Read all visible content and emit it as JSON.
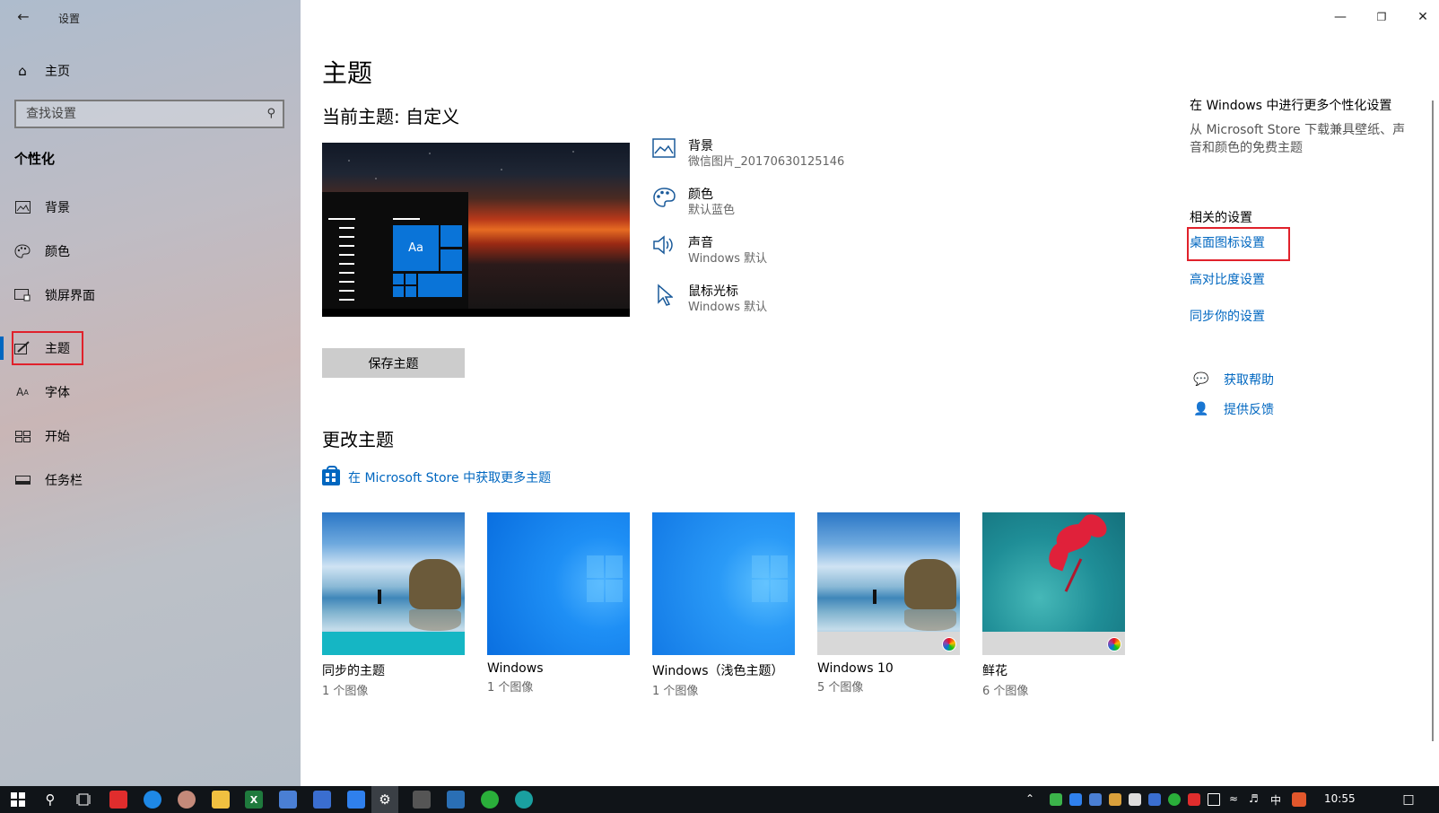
{
  "window": {
    "title": "设置"
  },
  "sidebar": {
    "home_label": "主页",
    "search_placeholder": "查找设置",
    "section_title": "个性化",
    "items": [
      {
        "label": "背景",
        "icon": "image-icon"
      },
      {
        "label": "颜色",
        "icon": "palette-icon"
      },
      {
        "label": "锁屏界面",
        "icon": "lockscreen-icon"
      },
      {
        "label": "主题",
        "icon": "theme-icon",
        "active": true
      },
      {
        "label": "字体",
        "icon": "font-icon"
      },
      {
        "label": "开始",
        "icon": "start-icon"
      },
      {
        "label": "任务栏",
        "icon": "taskbar-icon"
      }
    ]
  },
  "main": {
    "title": "主题",
    "current_theme": "当前主题: 自定义",
    "preview_aa": "Aa",
    "properties": [
      {
        "name": "背景",
        "value": "微信图片_20170630125146",
        "icon": "image-icon"
      },
      {
        "name": "颜色",
        "value": "默认蓝色",
        "icon": "palette-icon"
      },
      {
        "name": "声音",
        "value": "Windows 默认",
        "icon": "speaker-icon"
      },
      {
        "name": "鼠标光标",
        "value": "Windows 默认",
        "icon": "cursor-icon"
      }
    ],
    "save_button": "保存主题",
    "change_theme": "更改主题",
    "store_link": "在 Microsoft Store 中获取更多主题",
    "themes": [
      {
        "name": "同步的主题",
        "count": "1 个图像"
      },
      {
        "name": "Windows",
        "count": "1 个图像"
      },
      {
        "name": "Windows（浅色主题）",
        "count": "1 个图像"
      },
      {
        "name": "Windows 10",
        "count": "5 个图像"
      },
      {
        "name": "鲜花",
        "count": "6 个图像"
      }
    ]
  },
  "right_panel": {
    "more_title": "在 Windows 中进行更多个性化设置",
    "more_desc_line1": "从 Microsoft Store 下载兼具壁纸、声",
    "more_desc_line2": "音和颜色的免费主题",
    "related_title": "相关的设置",
    "links": [
      "桌面图标设置",
      "高对比度设置",
      "同步你的设置"
    ],
    "help": "获取帮助",
    "feedback": "提供反馈"
  },
  "taskbar": {
    "time": "10:55",
    "ime": "中"
  },
  "colors": {
    "accent": "#0067c0",
    "highlight_box": "#e0212b"
  }
}
